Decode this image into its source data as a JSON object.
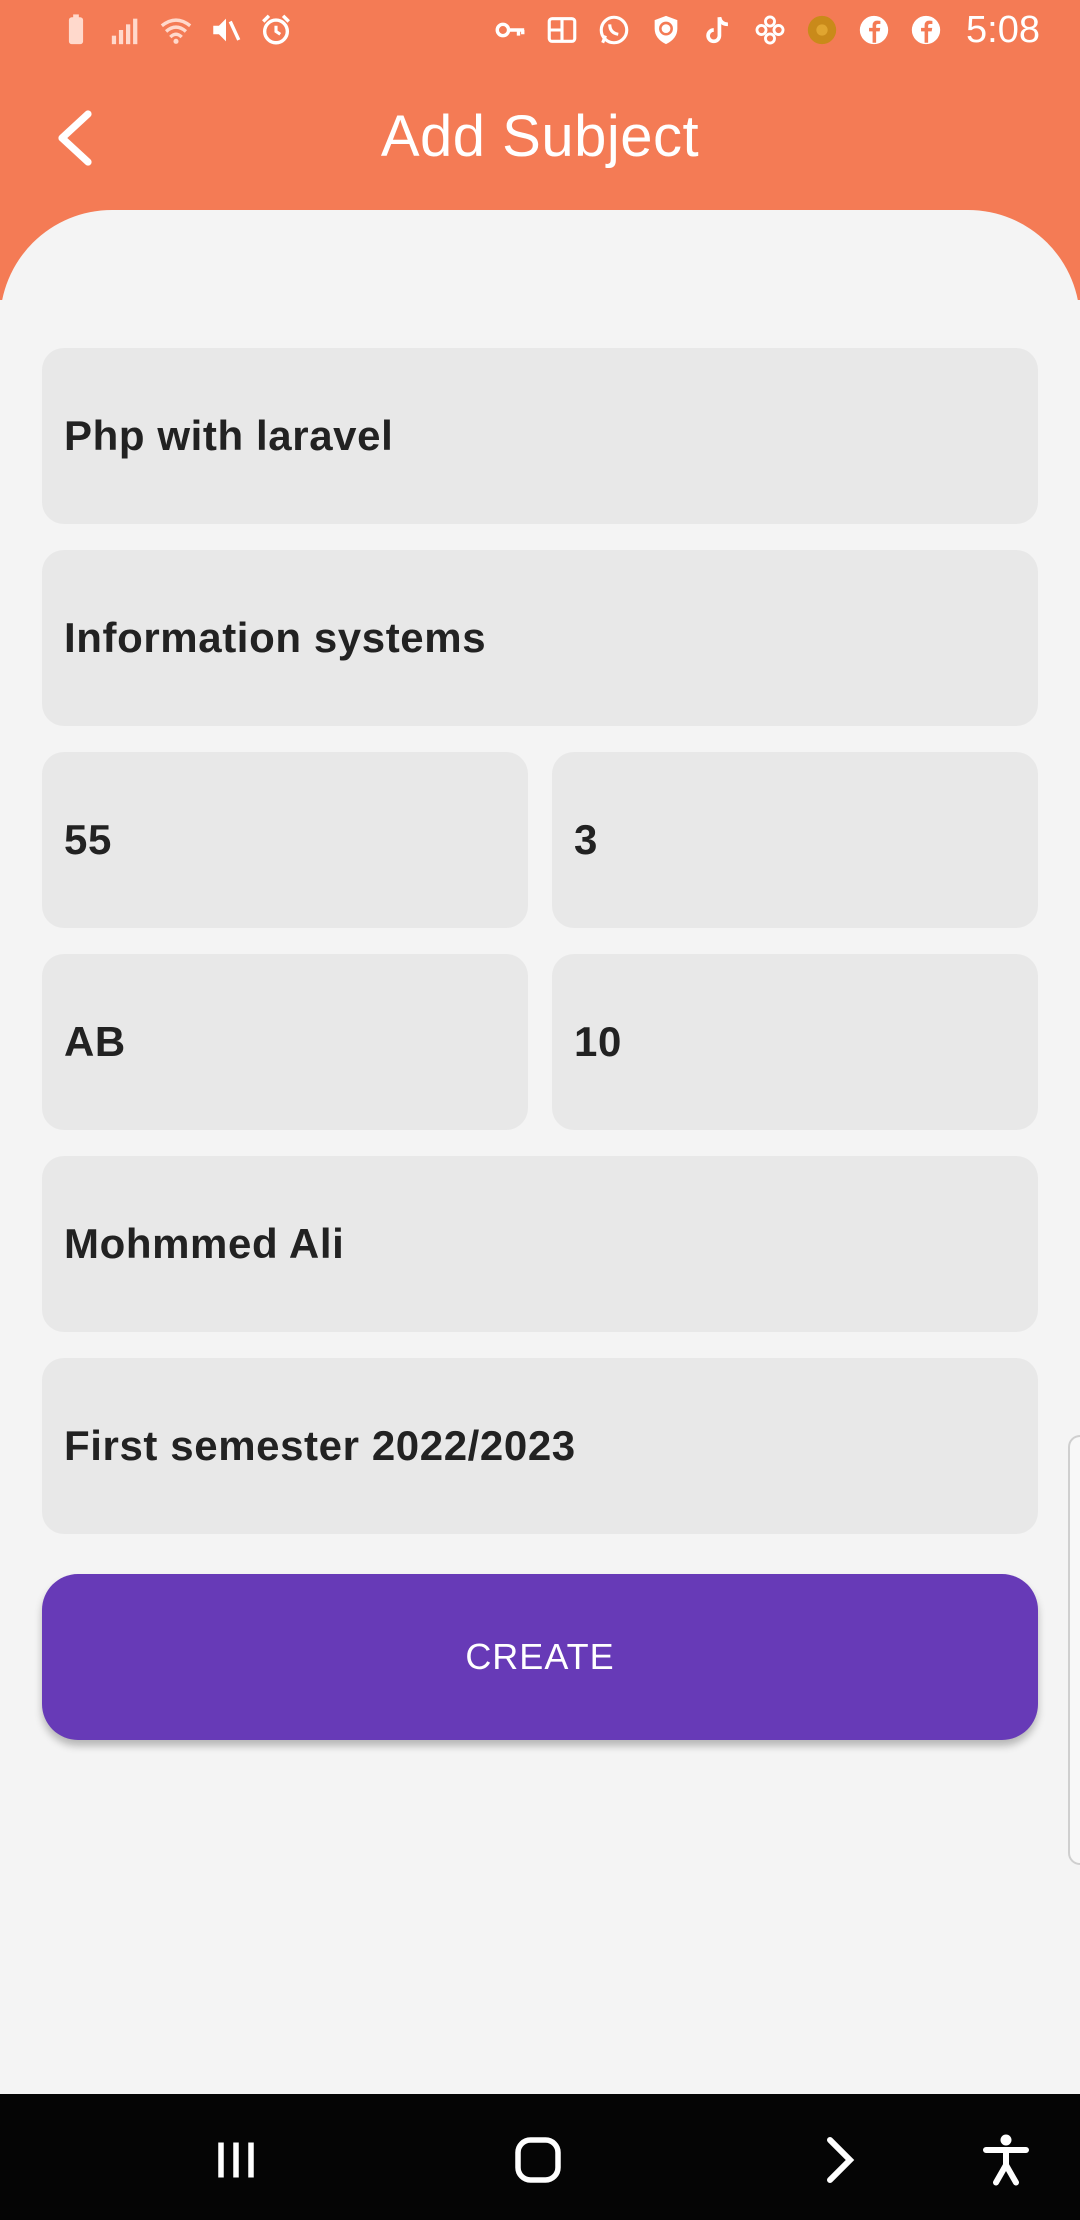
{
  "status_bar": {
    "time": "5:08",
    "left_icons": [
      "battery-icon",
      "signal-icon",
      "wifi-icon",
      "mute-icon",
      "alarm-icon"
    ],
    "right_icons": [
      "vpn-key-icon",
      "app-icon",
      "whatsapp-icon",
      "shield-icon",
      "tiktok-icon",
      "flower-app-icon",
      "circle-app-icon",
      "facebook-icon",
      "facebook-icon"
    ]
  },
  "header": {
    "title": "Add Subject",
    "back_icon": "chevron-left-icon",
    "background_color": "#F47B55"
  },
  "form": {
    "subject_name": "Php with laravel",
    "department": "Information systems",
    "value_a": "55",
    "value_b": "3",
    "value_c": "AB",
    "value_d": "10",
    "teacher": "Mohmmed Ali",
    "semester": "First semester 2022/2023"
  },
  "create_button": {
    "label": "CREATE",
    "color": "#673AB7"
  },
  "nav_bar": {
    "icons": [
      "recent-apps-icon",
      "home-icon",
      "back-arrow-icon",
      "accessibility-icon"
    ]
  }
}
